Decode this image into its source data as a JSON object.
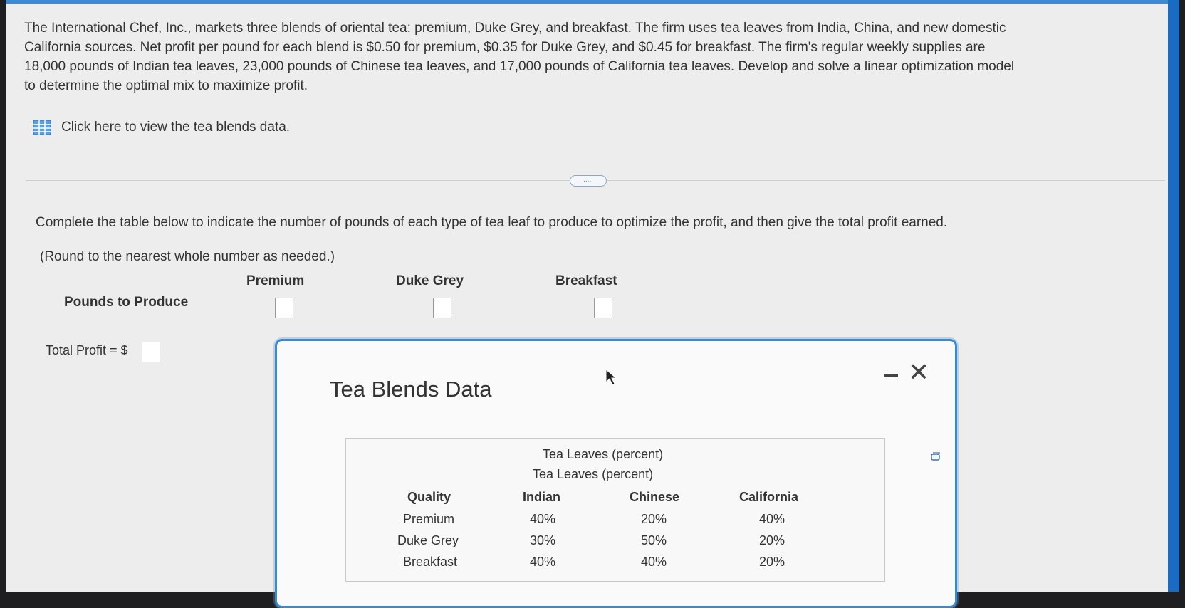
{
  "problem": {
    "lines": [
      "The International Chef, Inc., markets three blends of oriental tea: premium, Duke Grey, and breakfast. The firm uses tea leaves from India, China, and new domestic",
      "California sources. Net profit per pound for each blend is $0.50 for premium, $0.35 for Duke Grey, and $0.45 for breakfast. The firm's regular weekly supplies are",
      "18,000 pounds of Indian tea leaves, 23,000 pounds of Chinese tea leaves, and 17,000 pounds of California tea leaves. Develop and solve a linear optimization model",
      "to determine the optimal mix to maximize profit."
    ],
    "data_link": "Click here to view the tea blends data.",
    "data_link_icon": "table-grid-icon",
    "more_button": "....."
  },
  "question": {
    "instruction": "Complete the table below to indicate the number of pounds of each type of tea leaf to produce to optimize the profit, and then give the total profit earned.",
    "rounding": "(Round to the nearest whole number as needed.)",
    "columns": [
      "Premium",
      "Duke Grey",
      "Breakfast"
    ],
    "row_label": "Pounds to Produce",
    "inputs": {
      "premium": "",
      "duke_grey": "",
      "breakfast": ""
    },
    "total_profit_label": "Total Profit = $",
    "total_profit_value": ""
  },
  "dialog": {
    "title": "Tea Blends Data",
    "minimize_icon": "minimize-icon",
    "close_icon": "close-icon",
    "table": {
      "caption1": "Tea Leaves (percent)",
      "caption2": "Tea Leaves (percent)",
      "headers": [
        "Quality",
        "Indian",
        "Chinese",
        "California"
      ],
      "rows": [
        [
          "Premium",
          "40%",
          "20%",
          "40%"
        ],
        [
          "Duke Grey",
          "30%",
          "50%",
          "20%"
        ],
        [
          "Breakfast",
          "40%",
          "40%",
          "20%"
        ]
      ]
    }
  },
  "colors": {
    "accent": "#3a8ad0",
    "text": "#333333",
    "background": "#ededed"
  }
}
